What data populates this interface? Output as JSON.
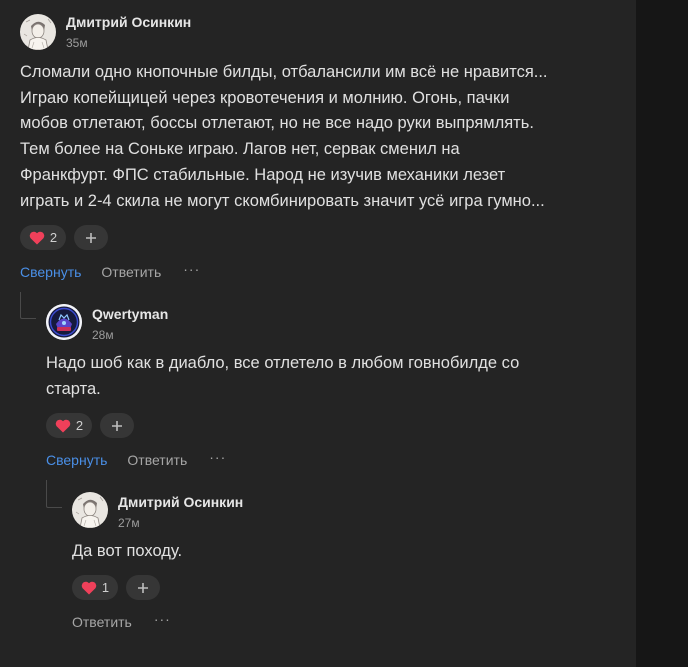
{
  "comments": [
    {
      "author": "Дмитрий Осинкин",
      "time": "35м",
      "lines": [
        "Сломали одно кнопочные билды, отбалансили им всё не нравится...",
        "Играю копейщицей через кровотечения и молнию. Огонь, пачки",
        "мобов отлетают, боссы отлетают, но не все надо руки выпрямлять.",
        "Тем более на Соньке играю. Лагов нет, сервак сменил на",
        "Франкфурт. ФПС стабильные. Народ не изучив механики лезет",
        "играть и 2-4 скила не могут скомбинировать значит усё игра гумно..."
      ],
      "likes": "2",
      "collapse_label": "Свернуть",
      "reply_label": "Ответить",
      "more_label": "···"
    },
    {
      "author": "Qwertyman",
      "time": "28м",
      "lines": [
        "Надо шоб как в диабло, все отлетело в любом говнобилде со",
        "старта."
      ],
      "likes": "2",
      "collapse_label": "Свернуть",
      "reply_label": "Ответить",
      "more_label": "···"
    },
    {
      "author": "Дмитрий Осинкин",
      "time": "27м",
      "lines": [
        "Да вот походу."
      ],
      "likes": "1",
      "reply_label": "Ответить",
      "more_label": "···"
    }
  ],
  "icons": {
    "heart": "heart-icon",
    "plus": "plus-icon",
    "avatar_dmitry": "sketch-portrait-avatar",
    "avatar_qwerty": "game-emblem-avatar"
  },
  "colors": {
    "background": "#242424",
    "accent": "#4a8fe7",
    "heart": "#f0405a"
  }
}
